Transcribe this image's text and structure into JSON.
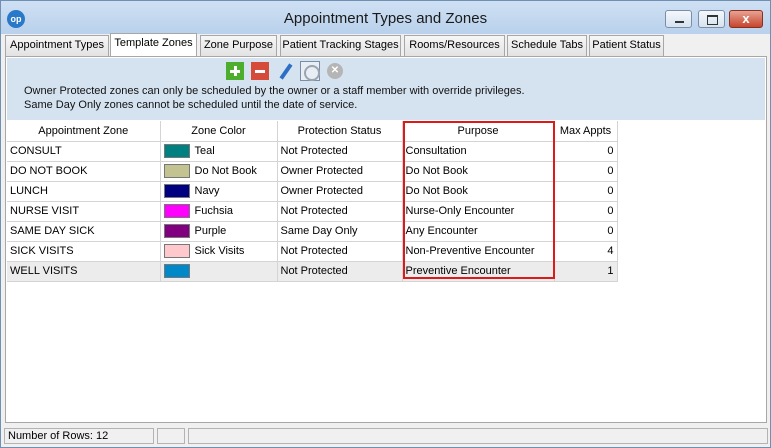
{
  "window": {
    "title": "Appointment Types and Zones",
    "app_icon_text": "op",
    "close_glyph": "x"
  },
  "tabs": [
    {
      "label": "Appointment Types",
      "active": false
    },
    {
      "label": "Template Zones",
      "active": true
    },
    {
      "label": "Zone Purpose",
      "active": false
    },
    {
      "label": "Patient Tracking Stages",
      "active": false
    },
    {
      "label": "Rooms/Resources",
      "active": false
    },
    {
      "label": "Schedule Tabs",
      "active": false
    },
    {
      "label": "Patient Status",
      "active": false
    }
  ],
  "toolbar": {
    "icons": [
      "add-icon",
      "delete-icon",
      "edit-icon",
      "view-icon",
      "cancel-icon"
    ]
  },
  "notes": [
    "Owner Protected zones can only be scheduled by the owner or a staff member with override privileges.",
    "Same Day Only zones cannot be scheduled until the date of service."
  ],
  "grid": {
    "headers": [
      "Appointment Zone",
      "Zone Color",
      "Protection Status",
      "Purpose",
      "Max Appts"
    ],
    "rows": [
      {
        "zone": "CONSULT",
        "color_hex": "#008080",
        "color_name": "Teal",
        "protection": "Not Protected",
        "purpose": "Consultation",
        "max": "0"
      },
      {
        "zone": "DO NOT BOOK",
        "color_hex": "#c3c392",
        "color_name": "Do Not Book",
        "protection": "Owner Protected",
        "purpose": "Do Not Book",
        "max": "0"
      },
      {
        "zone": "LUNCH",
        "color_hex": "#000080",
        "color_name": "Navy",
        "protection": "Owner Protected",
        "purpose": "Do Not Book",
        "max": "0"
      },
      {
        "zone": "NURSE VISIT",
        "color_hex": "#ff00ff",
        "color_name": "Fuchsia",
        "protection": "Not Protected",
        "purpose": "Nurse-Only Encounter",
        "max": "0"
      },
      {
        "zone": "SAME DAY SICK",
        "color_hex": "#800080",
        "color_name": "Purple",
        "protection": "Same Day Only",
        "purpose": "Any Encounter",
        "max": "0"
      },
      {
        "zone": "SICK VISITS",
        "color_hex": "#ffc8cd",
        "color_name": "Sick Visits",
        "protection": "Not Protected",
        "purpose": "Non-Preventive Encounter",
        "max": "4"
      },
      {
        "zone": "WELL VISITS",
        "color_hex": "#0088c8",
        "color_name": "",
        "protection": "Not Protected",
        "purpose": "Preventive Encounter",
        "max": "1",
        "selected": true
      }
    ]
  },
  "status": {
    "row_count": "Number of Rows: 12"
  },
  "colors": {
    "highlight_border": "#dd1a1a",
    "toolbar_bg": "#d5e3f1"
  }
}
